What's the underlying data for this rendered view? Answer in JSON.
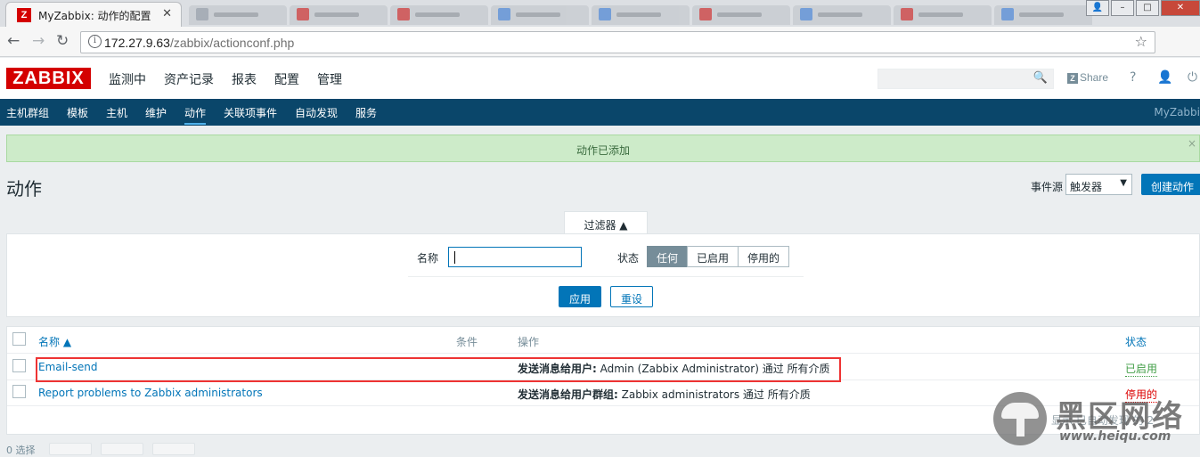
{
  "browser": {
    "active_tab_title": "MyZabbix: 动作的配置",
    "url_host": "172.27.9.63",
    "url_path": "/zabbix/actionconf.php"
  },
  "header": {
    "logo": "ZABBIX",
    "menu": [
      "监测中",
      "资产记录",
      "报表",
      "配置",
      "管理"
    ],
    "share": "Share",
    "help": "?"
  },
  "submenu": {
    "items": [
      "主机群组",
      "模板",
      "主机",
      "维护",
      "动作",
      "关联项事件",
      "自动发现",
      "服务"
    ],
    "node": "MyZabbi"
  },
  "message": {
    "text": "动作已添加",
    "close": "×"
  },
  "page": {
    "title": "动作",
    "event_source_label": "事件源",
    "event_source_value": "触发器",
    "create_button": "创建动作"
  },
  "filter": {
    "tab_label": "过滤器 ▲",
    "name_label": "名称",
    "name_value": "",
    "status_label": "状态",
    "status_options": [
      "任何",
      "已启用",
      "停用的"
    ],
    "status_selected": "任何",
    "apply": "应用",
    "reset": "重设"
  },
  "table": {
    "headers": {
      "name": "名称 ▲",
      "conditions": "条件",
      "operations": "操作",
      "status": "状态"
    },
    "rows": [
      {
        "name": "Email-send",
        "op_bold": "发送消息给用户:",
        "op_text": " Admin (Zabbix Administrator) 通过 所有介质",
        "status": "已启用"
      },
      {
        "name": "Report problems to Zabbix administrators",
        "op_bold": "发送消息给用户群组:",
        "op_text": " Zabbix administrators 通过 所有介质",
        "status": "停用的"
      }
    ],
    "footer_partial": "显示 已自动发现 的 2",
    "selected_count": "0 选择"
  },
  "watermark": {
    "big": "黑区网络",
    "small": "www.heiqu.com"
  }
}
